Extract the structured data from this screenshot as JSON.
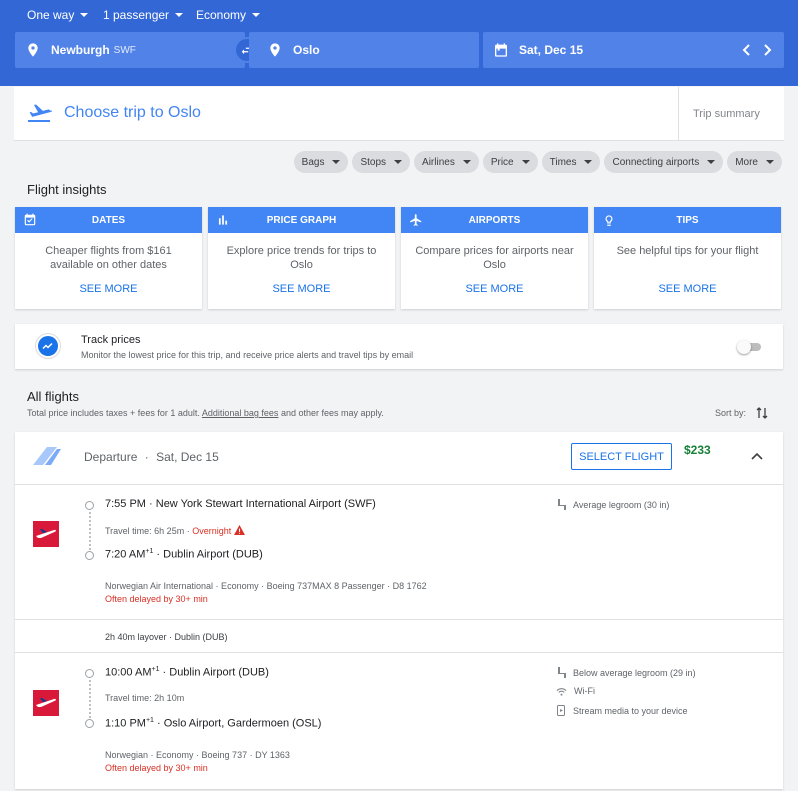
{
  "topbar": {
    "trip_type": "One way",
    "passengers": "1 passenger",
    "cabin": "Economy",
    "origin": "Newburgh",
    "origin_code": "SWF",
    "destination": "Oslo",
    "date": "Sat, Dec 15"
  },
  "header": {
    "title": "Choose trip to Oslo",
    "summary": "Trip summary"
  },
  "filters": [
    "Bags",
    "Stops",
    "Airlines",
    "Price",
    "Times",
    "Connecting airports",
    "More"
  ],
  "insights": {
    "title": "Flight insights",
    "cards": [
      {
        "title": "DATES",
        "body": "Cheaper flights from $161 available on other dates",
        "more": "SEE MORE"
      },
      {
        "title": "PRICE GRAPH",
        "body": "Explore price trends for trips to Oslo",
        "more": "SEE MORE"
      },
      {
        "title": "AIRPORTS",
        "body": "Compare prices for airports near Oslo",
        "more": "SEE MORE"
      },
      {
        "title": "TIPS",
        "body": "See helpful tips for your flight",
        "more": "SEE MORE"
      }
    ]
  },
  "track": {
    "title": "Track prices",
    "subtitle": "Monitor the lowest price for this trip, and receive price alerts and travel tips by email"
  },
  "all_flights": {
    "title": "All flights",
    "note_prefix": "Total price includes taxes + fees for 1 adult.",
    "note_link": "Additional bag fees",
    "note_suffix": "and other fees may apply.",
    "sort_label": "Sort by:"
  },
  "flight": {
    "label": "Departure",
    "date": "Sat, Dec 15",
    "select": "SELECT FLIGHT",
    "price": "$233",
    "seg1": {
      "dep_time": "7:55 PM",
      "dep_airport": "New York Stewart International Airport (SWF)",
      "travel_time": "Travel time: 6h 25m",
      "overnight": "Overnight",
      "arr_time": "7:20 AM",
      "arr_sup": "+1",
      "arr_airport": "Dublin Airport (DUB)",
      "details": "Norwegian Air International · Economy · Boeing 737MAX 8 Passenger · D8 1762",
      "delay": "Often delayed by 30+ min",
      "amenities": [
        "Average legroom (30 in)"
      ]
    },
    "layover": "2h 40m layover · Dublin (DUB)",
    "seg2": {
      "dep_time": "10:00 AM",
      "dep_sup": "+1",
      "dep_airport": "Dublin Airport (DUB)",
      "travel_time": "Travel time: 2h 10m",
      "arr_time": "1:10 PM",
      "arr_sup": "+1",
      "arr_airport": "Oslo Airport, Gardermoen (OSL)",
      "details": "Norwegian · Economy · Boeing 737 · DY 1363",
      "delay": "Often delayed by 30+ min",
      "amenities": [
        "Below average legroom (29 in)",
        "Wi-Fi",
        "Stream media to your device"
      ]
    }
  },
  "icons": {
    "location": "location-pin-icon",
    "swap": "swap-icon",
    "calendar": "calendar-icon",
    "takeoff": "takeoff-icon",
    "trend": "trend-icon"
  },
  "colors": {
    "topbar": "#3367d6",
    "field": "#5082e8",
    "accent": "#4285f4",
    "price": "#188038",
    "delay": "#d93025",
    "airline": "#d81939"
  }
}
